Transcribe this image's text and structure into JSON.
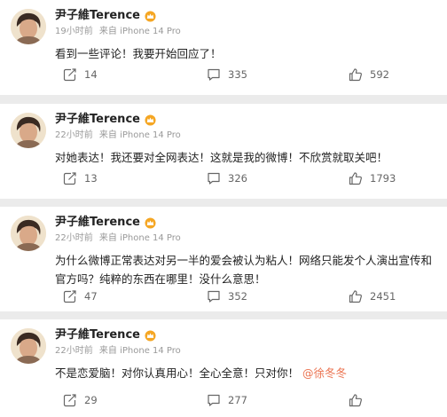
{
  "posts": [
    {
      "username": "尹子維Terence",
      "time": "19小时前",
      "source": "来自 iPhone 14 Pro",
      "content": "看到一些评论！我要开始回应了！",
      "mention": "",
      "reposts": "14",
      "comments": "335",
      "likes": "592"
    },
    {
      "username": "尹子維Terence",
      "time": "22小时前",
      "source": "来自 iPhone 14 Pro",
      "content": "对她表达！我还要对全网表达！这就是我的微博！不欣赏就取关吧！",
      "mention": "",
      "reposts": "13",
      "comments": "326",
      "likes": "1793"
    },
    {
      "username": "尹子維Terence",
      "time": "22小时前",
      "source": "来自 iPhone 14 Pro",
      "content": "为什么微博正常表达对另一半的爱会被认为粘人！网络只能发个人演出宣传和官方吗？纯粹的东西在哪里！没什么意思！",
      "mention": "",
      "reposts": "47",
      "comments": "352",
      "likes": "2451"
    },
    {
      "username": "尹子維Terence",
      "time": "22小时前",
      "source": "来自 iPhone 14 Pro",
      "content": "不是恋爱脑！对你认真用心！全心全意！只对你！",
      "mention": "@徐冬冬",
      "reposts": "29",
      "comments": "277",
      "likes": ""
    }
  ],
  "colors": {
    "mention": "#eb7350",
    "meta": "#999999",
    "background": "#ebebeb",
    "badge": "#f5a623"
  },
  "icons": {
    "repost": "repost-icon",
    "comment": "comment-icon",
    "like": "like-icon",
    "badge": "vip-crown-icon"
  }
}
